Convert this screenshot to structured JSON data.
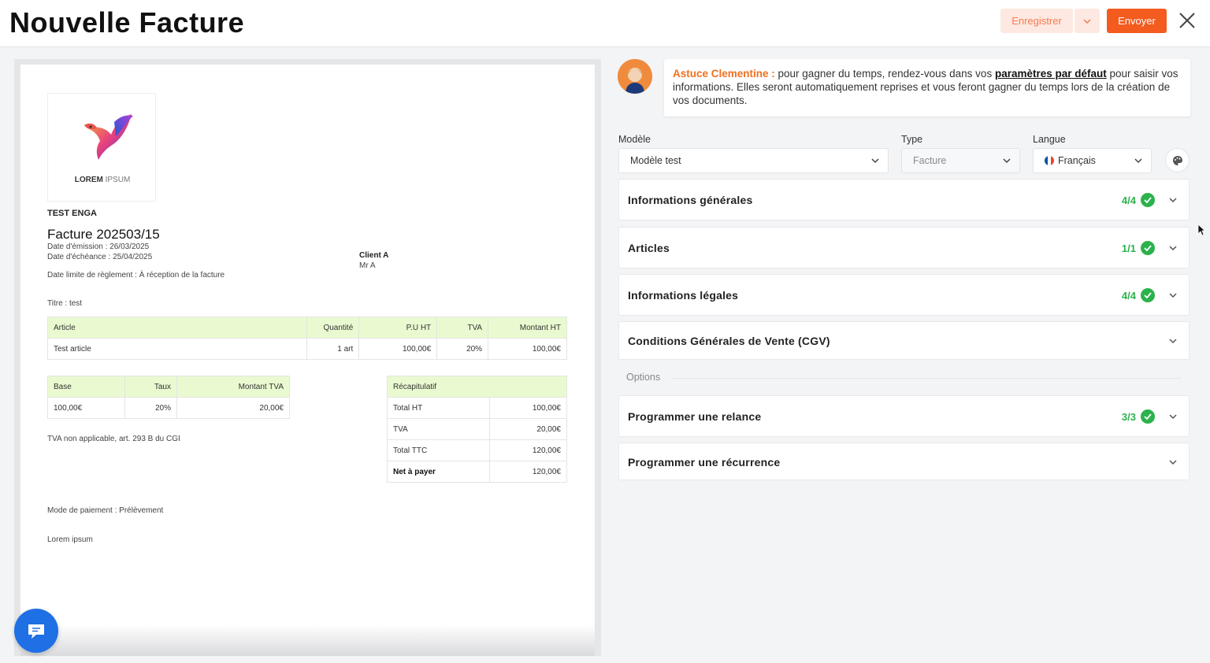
{
  "header": {
    "title": "Nouvelle Facture",
    "save_label": "Enregistrer",
    "send_label": "Envoyer",
    "colors": {
      "accent": "#f35b1f",
      "accent_light": "#fde9e1"
    }
  },
  "invoice": {
    "logo_text_bold": "LOREM",
    "logo_text_light": "IPSUM",
    "company": "TEST ENGA",
    "title": "Facture 202503/15",
    "issue_date": "Date d'émission : 26/03/2025",
    "due_date": "Date d'échéance : 25/04/2025",
    "payment_deadline": "Date limite de règlement : À réception de la facture",
    "client_name": "Client A",
    "client_contact": "Mr A",
    "subject": "Titre : test",
    "articles": {
      "headers": [
        "Article",
        "Quantité",
        "P.U HT",
        "TVA",
        "Montant HT"
      ],
      "rows": [
        [
          "Test article",
          "1 art",
          "100,00€",
          "20%",
          "100,00€"
        ]
      ]
    },
    "vat": {
      "headers": [
        "Base",
        "Taux",
        "Montant TVA"
      ],
      "rows": [
        [
          "100,00€",
          "20%",
          "20,00€"
        ]
      ]
    },
    "summary": {
      "header": "Récapitulatif",
      "rows": [
        [
          "Total HT",
          "100,00€"
        ],
        [
          "TVA",
          "20,00€"
        ],
        [
          "Total TTC",
          "120,00€"
        ],
        [
          "Net à payer",
          "120,00€"
        ]
      ]
    },
    "vat_note": "TVA non applicable, art. 293 B du CGI",
    "payment_mode": "Mode de paiement : Prélèvement",
    "footer_note": "Lorem ipsum"
  },
  "tip": {
    "lead": "Astuce Clementine :",
    "text_before": " pour gagner du temps, rendez-vous dans vos ",
    "link": "paramètres par défaut",
    "text_after": " pour saisir vos informations. Elles seront automatiquement reprises et vous feront gagner du temps lors de la création de vos documents."
  },
  "fields": {
    "model_label": "Modèle",
    "model_value": "Modèle test",
    "type_label": "Type",
    "type_value": "Facture",
    "lang_label": "Langue",
    "lang_value": "Français"
  },
  "sections": [
    {
      "title": "Informations générales",
      "count": "4/4",
      "complete": true
    },
    {
      "title": "Articles",
      "count": "1/1",
      "complete": true
    },
    {
      "title": "Informations légales",
      "count": "4/4",
      "complete": true
    },
    {
      "title": "Conditions Générales de Vente (CGV)",
      "count": "",
      "complete": false
    }
  ],
  "options": {
    "label": "Options",
    "sections": [
      {
        "title": "Programmer une relance",
        "count": "3/3",
        "complete": true
      },
      {
        "title": "Programmer une récurrence",
        "count": "",
        "complete": false
      }
    ]
  },
  "status_color": "#2bb24c",
  "icons": [
    "close-icon",
    "chevron-down-icon",
    "check-icon",
    "palette-icon",
    "chat-icon",
    "avatar",
    "logo-bird",
    "france-flag-icon"
  ]
}
